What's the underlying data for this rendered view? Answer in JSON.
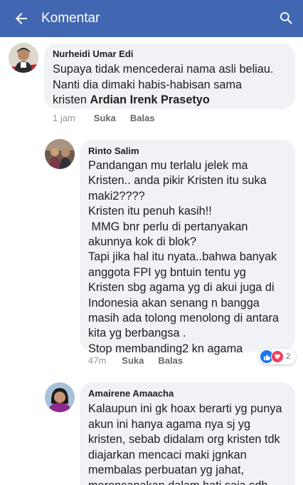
{
  "header": {
    "title": "Komentar",
    "back_icon": "arrow-left-icon",
    "search_icon": "search-icon",
    "bg_color": "#4267b2"
  },
  "comments": [
    {
      "author": "Nurheidi Umar Edi",
      "lines": [
        "Supaya  tidak  mencederai  nama asli beliau.",
        "Nanti dia  dimaki habis-habisan sama"
      ],
      "last_prefix": "kristen ",
      "mention": "Ardian Irenk Prasetyo",
      "time": "1 jam",
      "like": "Suka",
      "reply": "Balas"
    },
    {
      "author": "Rinto Salim",
      "lines": [
        "Pandangan mu terlalu jelek ma",
        "Kristen.. anda pikir Kristen itu suka",
        "maki2????",
        "Kristen itu penuh kasih!!",
        " MMG bnr perlu di pertanyakan",
        "akunnya kok di blok?",
        "Tapi jika hal itu nyata..bahwa banyak",
        "anggota FPI yg bntuin tentu yg",
        "Kristen sbg agama yg di akui juga di",
        "Indonesia akan senang n bangga",
        "masih ada tolong menolong di antara",
        "kita yg berbangsa .",
        "Stop membanding2 kn agama"
      ],
      "time": "47m",
      "like": "Suka",
      "reply": "Balas",
      "reactions": {
        "like_icon": "thumbs-up-icon",
        "love_icon": "heart-icon",
        "count": "2"
      }
    },
    {
      "author": "Amairene Amaacha",
      "lines": [
        "Kalaupun  ini gk hoax berarti yg punya",
        "akun ini hanya agama nya sj yg",
        "kristen, sebab didalam org kristen tdk",
        "diajarkan mencaci maki jgnkan",
        "membalas perbuatan yg jahat,",
        "merencanakan dalam hati saja sdh"
      ]
    }
  ]
}
